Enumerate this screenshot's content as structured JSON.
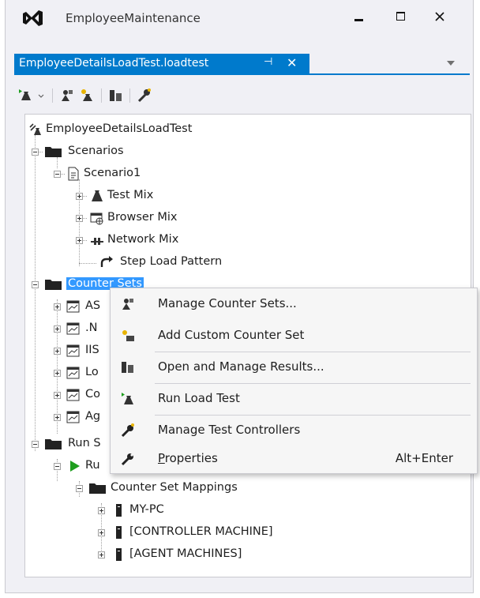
{
  "window": {
    "title": "EmployeeMaintenance"
  },
  "tab": {
    "label": "EmployeeDetailsLoadTest.loadtest",
    "pin_glyph": "⊣",
    "close_glyph": "✕"
  },
  "tree": {
    "root": "EmployeeDetailsLoadTest",
    "scenarios": "Scenarios",
    "scenario1": "Scenario1",
    "test_mix": "Test Mix",
    "browser_mix": "Browser Mix",
    "network_mix": "Network Mix",
    "step_load": "Step Load Pattern",
    "counter_sets": "Counter Sets",
    "cs_items": [
      "AS",
      ".N",
      "IIS",
      "Lo",
      "Co",
      "Ag"
    ],
    "run_settings": "Run S",
    "run1": "Ru",
    "mappings": "Counter Set Mappings",
    "my_pc": "MY-PC",
    "controller": "[CONTROLLER MACHINE]",
    "agents": "[AGENT MACHINES]"
  },
  "context_menu": {
    "manage_counter_sets": "Manage Counter Sets...",
    "add_custom": "Add Custom Counter Set",
    "open_results": "Open and Manage Results...",
    "run_load_test": "Run Load Test",
    "manage_controllers": "Manage Test Controllers",
    "properties": "Properties",
    "properties_shortcut": "Alt+Enter"
  },
  "colors": {
    "accent": "#007acc",
    "selection": "#3399ff",
    "play_green": "#1e9e1e"
  }
}
